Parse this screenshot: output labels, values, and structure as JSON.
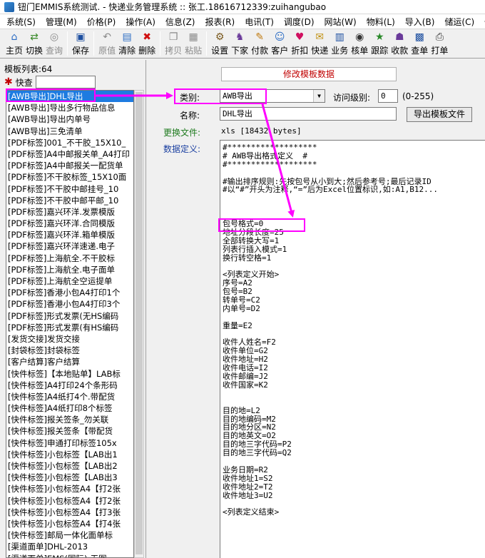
{
  "window": {
    "title": "钮门EMMIS系统测试. - 快递业务管理系统 :: 张工.18616712339:zuihangubao"
  },
  "menu": [
    "系统(S)",
    "管理(M)",
    "价格(P)",
    "操作(A)",
    "信息(Z)",
    "报表(R)",
    "电讯(T)",
    "调度(D)",
    "网站(W)",
    "物料(L)",
    "导入(B)",
    "储运(C)",
    "代派"
  ],
  "toolbar": [
    {
      "label": "主页",
      "icon": "home-icon",
      "glyph": "⌂",
      "color": "#2b6cc4",
      "enabled": true
    },
    {
      "label": "切换",
      "icon": "switch-icon",
      "glyph": "⇄",
      "color": "#3a8a2a",
      "enabled": true
    },
    {
      "label": "查询",
      "icon": "binoculars-icon",
      "glyph": "◎",
      "color": "#8a8a8a",
      "enabled": false
    },
    {
      "label": "保存",
      "icon": "save-icon",
      "glyph": "▣",
      "color": "#1d4fa0",
      "enabled": true
    },
    {
      "label": "原值",
      "icon": "undo-icon",
      "glyph": "↶",
      "color": "#8a8a8a",
      "enabled": false
    },
    {
      "label": "清除",
      "icon": "clear-icon",
      "glyph": "▤",
      "color": "#2b6cc4",
      "enabled": true
    },
    {
      "label": "删除",
      "icon": "delete-icon",
      "glyph": "✖",
      "color": "#d01010",
      "enabled": true
    },
    {
      "label": "拷贝",
      "icon": "copy-icon",
      "glyph": "❐",
      "color": "#8a8a8a",
      "enabled": false
    },
    {
      "label": "粘贴",
      "icon": "paste-icon",
      "glyph": "▦",
      "color": "#8a8a8a",
      "enabled": false
    },
    {
      "label": "设置",
      "icon": "settings-icon",
      "glyph": "⚙",
      "color": "#7a5a20",
      "enabled": true
    },
    {
      "label": "下家",
      "icon": "next-party-icon",
      "glyph": "♞",
      "color": "#6a3a9a",
      "enabled": true
    },
    {
      "label": "付款",
      "icon": "payment-icon",
      "glyph": "✎",
      "color": "#c07a10",
      "enabled": true
    },
    {
      "label": "客户",
      "icon": "customers-icon",
      "glyph": "☺",
      "color": "#2b6cc4",
      "enabled": true
    },
    {
      "label": "折扣",
      "icon": "discount-icon",
      "glyph": "♥",
      "color": "#d01060",
      "enabled": true
    },
    {
      "label": "快递",
      "icon": "express-icon",
      "glyph": "✉",
      "color": "#c09010",
      "enabled": true
    },
    {
      "label": "业务",
      "icon": "business-icon",
      "glyph": "▥",
      "color": "#1d4fa0",
      "enabled": true
    },
    {
      "label": "核单",
      "icon": "verify-icon",
      "glyph": "◉",
      "color": "#333333",
      "enabled": true
    },
    {
      "label": "跟踪",
      "icon": "tracking-icon",
      "glyph": "★",
      "color": "#2a8a2a",
      "enabled": true
    },
    {
      "label": "收款",
      "icon": "receipt-icon",
      "glyph": "☗",
      "color": "#6a3a9a",
      "enabled": true
    },
    {
      "label": "查单",
      "icon": "query-order-icon",
      "glyph": "▩",
      "color": "#1d4fa0",
      "enabled": true
    },
    {
      "label": "打单",
      "icon": "print-icon",
      "glyph": "⎙",
      "color": "#333333",
      "enabled": true
    }
  ],
  "left": {
    "title": "模板列表:64",
    "search_label": "快查",
    "search_value": "",
    "items": [
      "[AWB导出]DHL导出",
      "[AWB导出]导出多行物品信息",
      "[AWB导出]导出内单号",
      "[AWB导出]三免清单",
      "[PDF标签]001_不干胶_15X10_",
      "[PDF标签]A4中邮报关单_A4打印",
      "[PDF标签]A4中邮报关一配货单",
      "[PDF标签]不干胶标签_15X10面",
      "[PDF标签]不干胶中邮挂号_10",
      "[PDF标签]不干胶中邮平邮_10",
      "[PDF标签]嘉兴环洋.发票模版",
      "[PDF标签]嘉兴环洋.合同模版",
      "[PDF标签]嘉兴环洋.箱单模版",
      "[PDF标签]嘉兴环洋速递.电子",
      "[PDF标签]上海航全.不干胶标",
      "[PDF标签]上海航全.电子面单",
      "[PDF标签]上海航全空运提单",
      "[PDF标签]香港小包A4打印1个",
      "[PDF标签]香港小包A4打印3个",
      "[PDF标签]形式发票(无HS编码",
      "[PDF标签]形式发票(有HS编码",
      "[发货交接]发货交接",
      "[封袋标签]封袋标签",
      "[客户结算]客户结算",
      "[快件标签]【本地贴单】LAB标",
      "[快件标签]A4打印24个条形码",
      "[快件标签]A4纸打4个.带配货",
      "[快件标签]A4纸打印8个标签",
      "[快件标签]报关签条_勿关联",
      "[快件标签]报关签条【带配货",
      "[快件标签]申通打印标签105x",
      "[快件标签]小包标签【LAB出1",
      "[快件标签]小包标签【LAB出2",
      "[快件标签]小包标签【LAB出3",
      "[快件标签]小包标签A4【打2张",
      "[快件标签]小包标签A4【打2张",
      "[快件标签]小包标签A4【打3张",
      "[快件标签]小包标签A4【打4张",
      "[快件标签]邮局一体化面单标",
      "[渠道面单]DHL-2013",
      "[渠道面单]EMS(国际)-无图"
    ]
  },
  "right": {
    "form_title": "修改模板数据",
    "category_label": "类别:",
    "category_value": "AWB导出",
    "access_label": "访问级别:",
    "access_value": "0",
    "access_range": "(0-255)",
    "name_label": "名称:",
    "name_value": "DHL导出",
    "export_button": "导出模板文件",
    "file_label": "更换文件:",
    "file_value": "xls [18432 bytes]",
    "def_label": "数据定义:",
    "definition": [
      "#*******************",
      "# AWB导出格式定义  #",
      "#*******************",
      "",
      "#输出排序规则:先按包号从小到大;然后参考号;最后记录ID",
      "#以“#”开头为注释,“=”后为Excel位置标识,如:A1,B12...",
      "",
      "",
      "",
      "包号格式=0",
      "地址分段长度=25",
      "全部转换大写=1",
      "列表行插入模式=1",
      "换行转空格=1",
      "",
      "<列表定义开始>",
      "序号=A2",
      "包号=B2",
      "转单号=C2",
      "内单号=D2",
      "",
      "重量=E2",
      "",
      "收件人姓名=F2",
      "收件单位=G2",
      "收件地址=H2",
      "收件电话=I2",
      "收件邮编=J2",
      "收件国家=K2",
      "",
      "",
      "目的地=L2",
      "目的地编码=M2",
      "目的地分区=N2",
      "目的地英文=O2",
      "目的地三字代码=P2",
      "目的地三字代码=Q2",
      "",
      "业务日期=R2",
      "收件地址1=S2",
      "收件地址2=T2",
      "收件地址3=U2",
      "",
      "<列表定义结束>"
    ]
  }
}
